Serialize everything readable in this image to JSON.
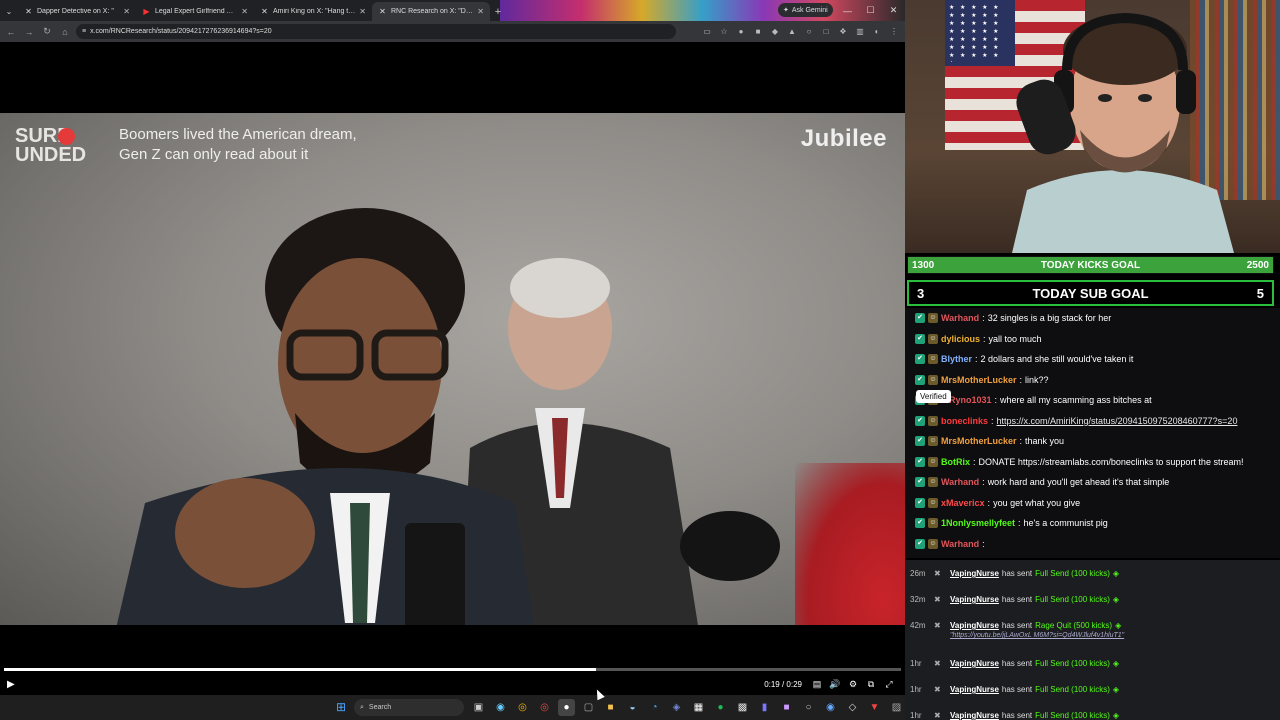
{
  "browser": {
    "tabs": [
      {
        "title": "Dapper Detective on X: \"",
        "favicon": "x-logo-icon",
        "active": false
      },
      {
        "title": "Legal Expert Girlfriend Attack",
        "favicon": "youtube-icon",
        "active": false
      },
      {
        "title": "Amiri King on X: \"Hang tha",
        "favicon": "x-logo-icon",
        "active": false
      },
      {
        "title": "RNC Research on X: \"Dem",
        "favicon": "x-logo-icon",
        "active": true
      }
    ],
    "new_tab": "+",
    "ask_gemini": "Ask Gemini",
    "url": "x.com/RNCResearch/status/2094217276236914694?s=20"
  },
  "video": {
    "brand_left": "SURR UNDED",
    "caption_line1": "Boomers lived the American dream,",
    "caption_line2": "Gen Z can only read about it",
    "brand_right": "Jubilee",
    "progress": 0.66,
    "time": "0:19 / 0:29"
  },
  "taskbar": {
    "search_placeholder": "Search"
  },
  "goals": {
    "kicks": {
      "current": "1300",
      "title": "TODAY KICKS GOAL",
      "target": "2500",
      "fraction": 0.52,
      "color": "#3ca23c"
    },
    "subs": {
      "current": "3",
      "title": "TODAY SUB GOAL",
      "target": "5",
      "fraction": 0.0,
      "color": "#2bbd3c"
    }
  },
  "chat": [
    {
      "user": "Warhand",
      "color": "#e0555a",
      "message": "32 singles is a big stack for her"
    },
    {
      "user": "dylicious",
      "color": "#f0b030",
      "message": "yall too much"
    },
    {
      "user": "Blyther",
      "color": "#7fb3ff",
      "message": "2 dollars and she still would've taken it"
    },
    {
      "user": "MrsMotherLucker",
      "color": "#f0a040",
      "message": "link??"
    },
    {
      "user": "efRyno1031",
      "color": "#e0555a",
      "message": "where all my scamming ass bitches at"
    },
    {
      "user": "boneclinks",
      "color": "#ff3b3b",
      "message": "https://x.com/AmiriKing/status/2094150975208460777?s=20"
    },
    {
      "user": "MrsMotherLucker",
      "color": "#f0a040",
      "message": "thank you"
    },
    {
      "user": "BotRix",
      "color": "#53fc18",
      "message": "DONATE https://streamlabs.com/boneclinks to support the stream!"
    },
    {
      "user": "Warhand",
      "color": "#e0555a",
      "message": "work hard and you'll get ahead it's that simple"
    },
    {
      "user": "xMavericx",
      "color": "#ff4a4a",
      "message": "you get what you give"
    },
    {
      "user": "1Nonlysmellyfeet",
      "color": "#53fc18",
      "message": "he's a communist pig"
    },
    {
      "user": "Warhand",
      "color": "#e0555a",
      "message": ""
    }
  ],
  "verified_tooltip": "Verified",
  "gifts": [
    {
      "ago": "26m",
      "user": "VapingNurse",
      "text": "has sent",
      "item": "Full Send (100 kicks)",
      "url": ""
    },
    {
      "ago": "32m",
      "user": "VapingNurse",
      "text": "has sent",
      "item": "Full Send (100 kicks)",
      "url": ""
    },
    {
      "ago": "42m",
      "user": "VapingNurse",
      "text": "has sent",
      "item": "Rage Quit (500 kicks)",
      "url": "\"https://youtu.be/jjLAwOxL M6M?si=Qd4WJluf4v1hluT1\""
    },
    {
      "ago": "1hr",
      "user": "VapingNurse",
      "text": "has sent",
      "item": "Full Send (100 kicks)",
      "url": ""
    },
    {
      "ago": "1hr",
      "user": "VapingNurse",
      "text": "has sent",
      "item": "Full Send (100 kicks)",
      "url": ""
    },
    {
      "ago": "1hr",
      "user": "VapingNurse",
      "text": "has sent",
      "item": "Full Send (100 kicks)",
      "url": ""
    }
  ]
}
